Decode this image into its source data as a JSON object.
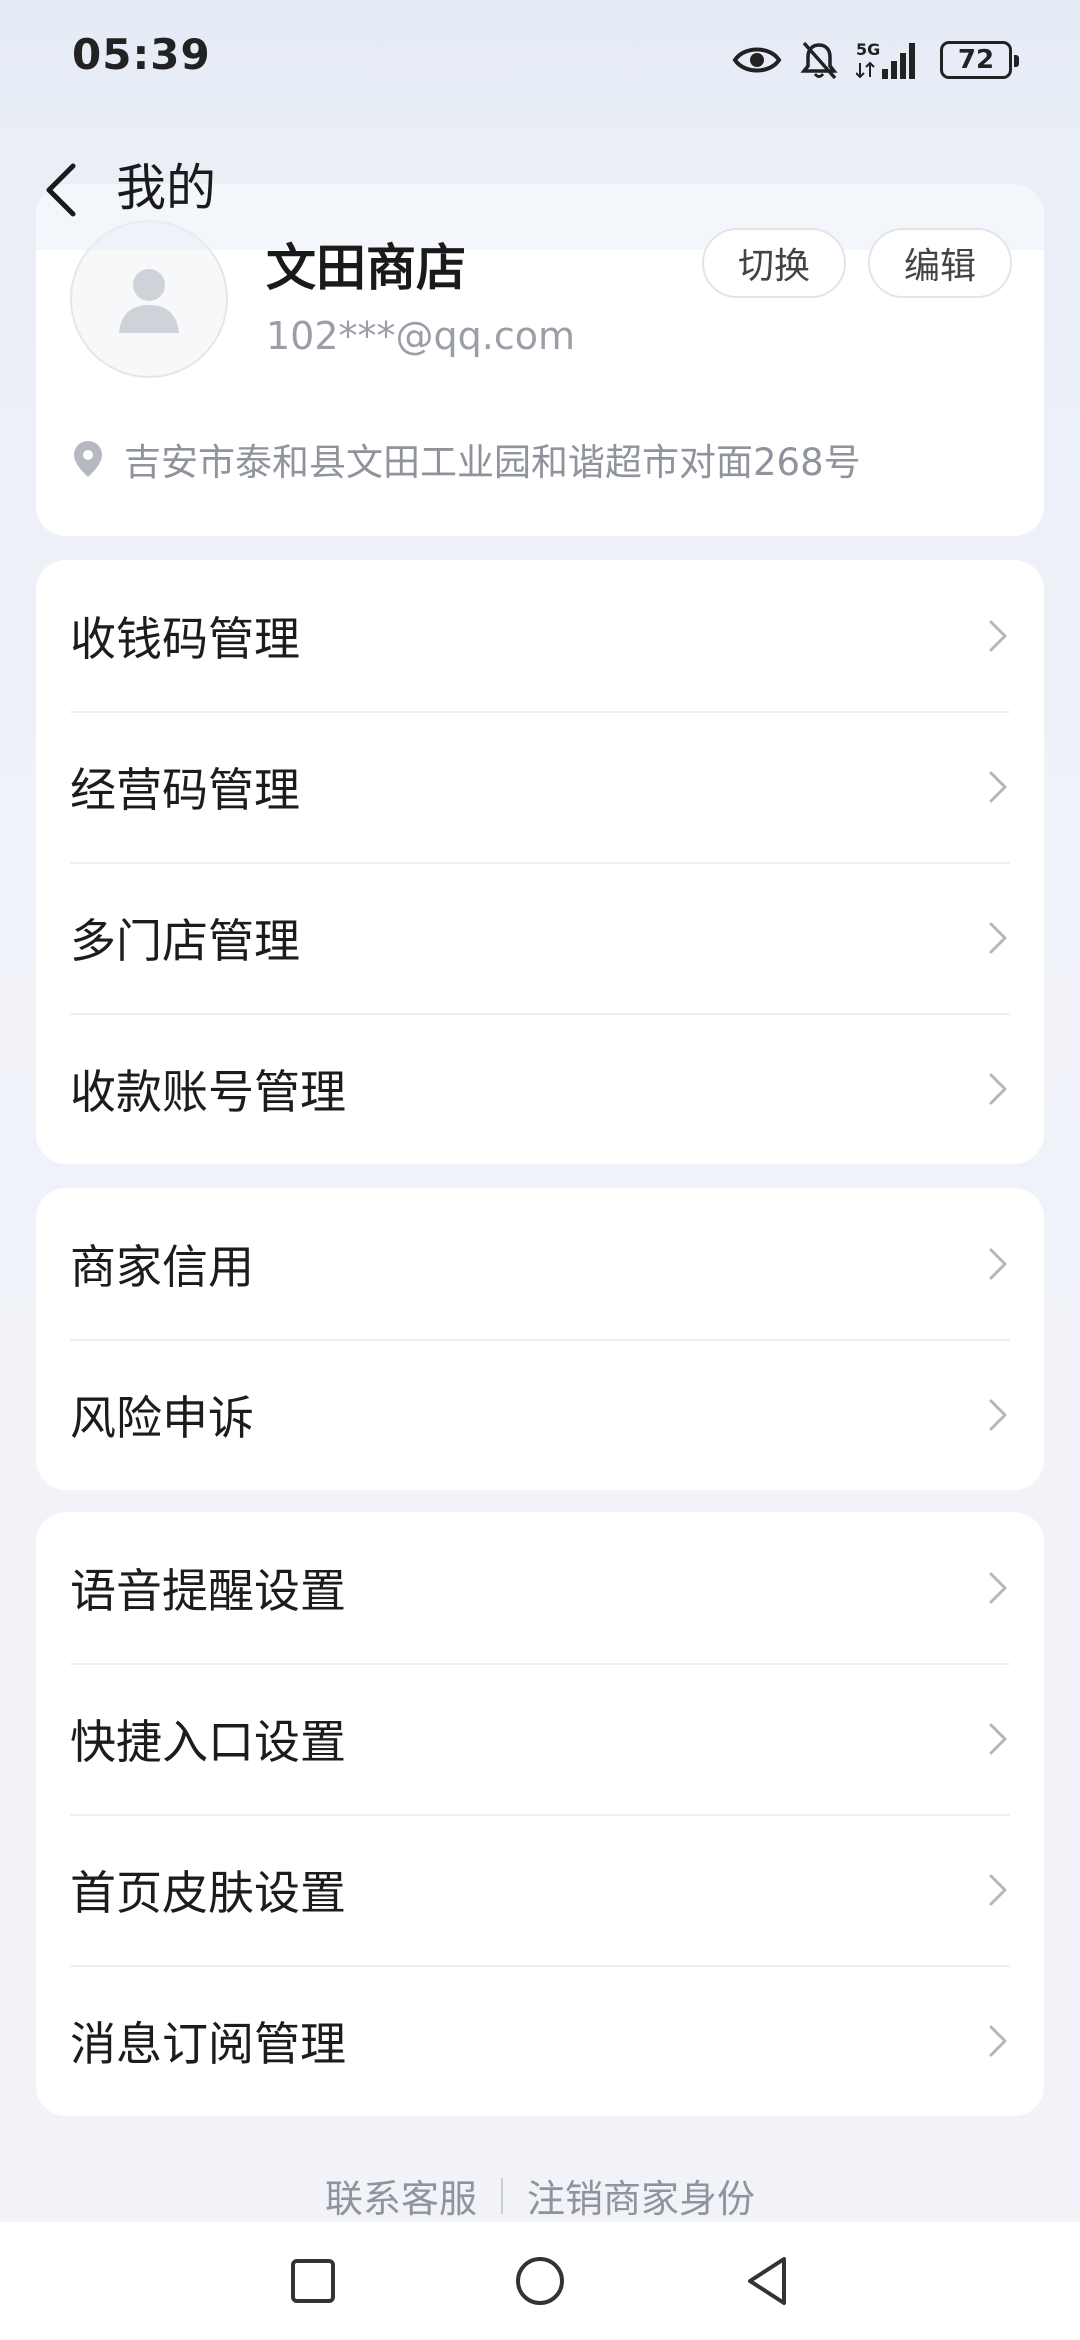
{
  "status_bar": {
    "time": "05:39",
    "network": "5G",
    "battery": "72",
    "icons": [
      "eye-icon",
      "bell-muted-icon",
      "5g-signal-icon",
      "battery-icon"
    ]
  },
  "header": {
    "title": "我的",
    "back_icon": "chevron-left-icon"
  },
  "profile": {
    "store_name": "文田商店",
    "email": "102***@qq.com",
    "address": "吉安市泰和县文田工业园和谐超市对面268号",
    "switch_label": "切换",
    "edit_label": "编辑",
    "avatar_icon": "user-avatar-icon",
    "location_icon": "location-pin-icon"
  },
  "groups": [
    {
      "items": [
        {
          "label": "收钱码管理"
        },
        {
          "label": "经营码管理"
        },
        {
          "label": "多门店管理"
        },
        {
          "label": "收款账号管理"
        }
      ]
    },
    {
      "items": [
        {
          "label": "商家信用"
        },
        {
          "label": "风险申诉"
        }
      ]
    },
    {
      "items": [
        {
          "label": "语音提醒设置"
        },
        {
          "label": "快捷入口设置"
        },
        {
          "label": "首页皮肤设置"
        },
        {
          "label": "消息订阅管理"
        }
      ]
    }
  ],
  "footer": {
    "contact_label": "联系客服",
    "cancel_label": "注销商家身份"
  },
  "nav_bar": {
    "icons": [
      "recents-square-icon",
      "home-circle-icon",
      "back-triangle-icon"
    ]
  },
  "colors": {
    "background": "#eef1f8",
    "card": "#ffffff",
    "text_primary": "#1a1a1a",
    "text_secondary": "#9a9ea6",
    "divider": "#eeeff2"
  }
}
